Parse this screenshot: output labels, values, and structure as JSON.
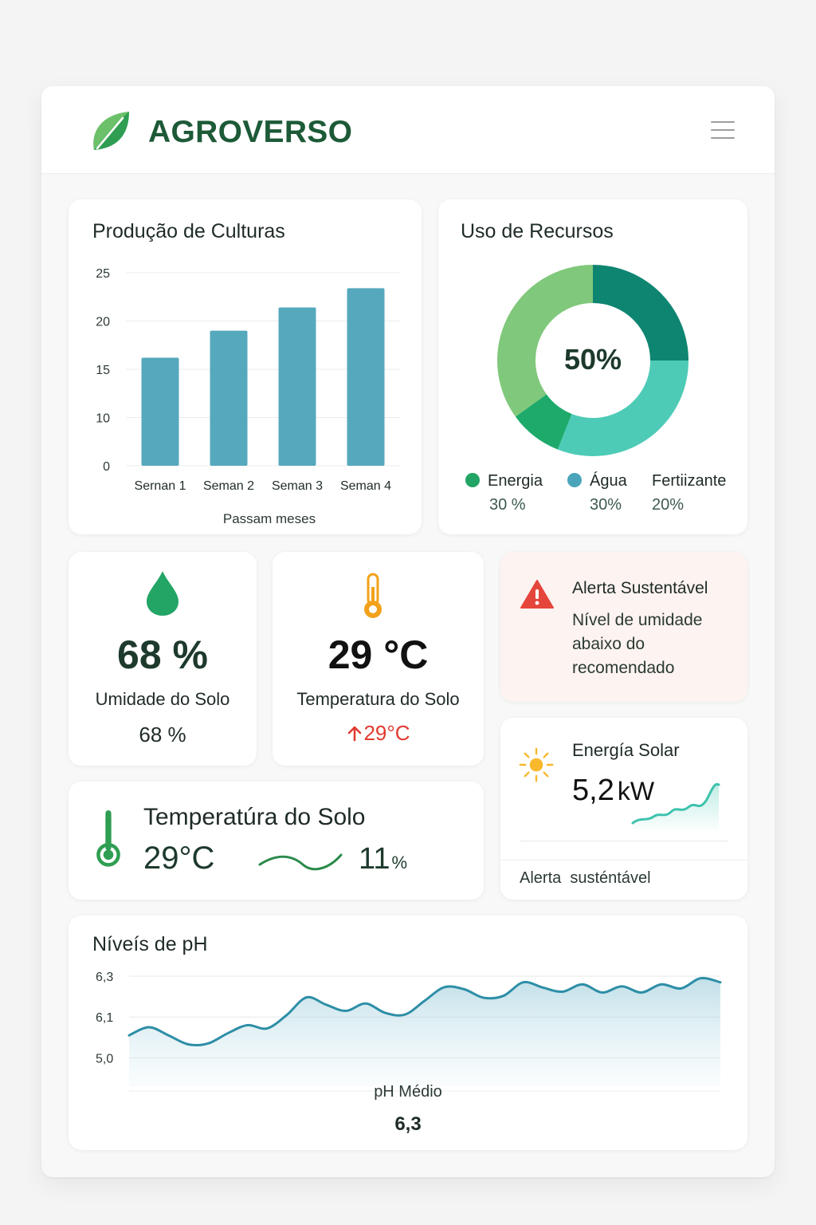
{
  "app": {
    "brand": "AGROVERSO"
  },
  "colors": {
    "brand": "#1d5a37",
    "bar": "#56a8bd",
    "line": "#2d8ea6",
    "alert": "#e03a2f"
  },
  "crop_card": {
    "title": "Produção de Culturas"
  },
  "resources_card": {
    "title": "Uso de Recursos",
    "center_value": "50%",
    "legend": [
      {
        "name": "Energia",
        "pct": "30 %",
        "color": "#22a565"
      },
      {
        "name": "Água",
        "pct": "30%",
        "color": "#4aa5ba"
      },
      {
        "name": "Fertiizante",
        "pct": "20%",
        "color": "#81c97d"
      }
    ]
  },
  "moisture_card": {
    "icon": "water-drop-icon",
    "value": "68 %",
    "label": "Umidade do Solo",
    "sub": "68 %"
  },
  "soil_temp_card": {
    "icon": "thermometer-icon",
    "value": "29 °C",
    "label": "Temperatura do Solo",
    "change": "29°C"
  },
  "alert_card": {
    "icon": "warning-icon",
    "title": "Alerta Sustentável",
    "line1": "Nível de umidade",
    "line2": "abaixo do",
    "line3": "recomendado"
  },
  "solar_card": {
    "icon": "sun-icon",
    "title": "Energía Solar",
    "value": "5,2",
    "unit": "kW",
    "footer": "Alerta  susténtável"
  },
  "soil_temp_wide": {
    "icon": "thermometer-icon",
    "title": "Temperatúra do Solo",
    "value": "29°C",
    "percent": "11",
    "percent_unit": "%"
  },
  "ph_card": {
    "title": "Níveís de pH",
    "avg_label": "pH Médio",
    "avg_value": "6,3"
  },
  "chart_data": [
    {
      "type": "bar",
      "title": "Produção de Culturas",
      "categories": [
        "Sernan 1",
        "Seman 2",
        "Seman 3",
        "Seman 4"
      ],
      "values": [
        14,
        17.5,
        20.5,
        23
      ],
      "xlabel": "Passam meses",
      "ylabel": "",
      "ylim": [
        0,
        25
      ],
      "yticks": [
        {
          "label": "25",
          "value": 25
        },
        {
          "label": "20",
          "value": 20
        },
        {
          "label": "15",
          "value": 15
        },
        {
          "label": "10",
          "value": 10
        },
        {
          "label": "0",
          "value": 0
        }
      ],
      "grid": true
    },
    {
      "type": "pie",
      "title": "Uso de Recursos",
      "slices": [
        {
          "value": 25,
          "color": "#0e8571"
        },
        {
          "value": 31,
          "color": "#4ecbb7"
        },
        {
          "value": 9,
          "color": "#1daa6b"
        },
        {
          "value": 35,
          "color": "#80c87b"
        }
      ]
    },
    {
      "type": "area",
      "title": "Níveís de pH",
      "x": [
        0,
        1,
        2,
        3,
        4,
        5,
        6,
        7,
        8,
        9,
        10,
        11,
        12,
        13,
        14,
        15,
        16,
        17,
        18,
        19,
        20,
        21,
        22,
        23,
        24,
        25,
        26,
        27,
        28,
        29,
        30
      ],
      "values": [
        5.55,
        5.75,
        5.55,
        5.33,
        5.35,
        5.6,
        5.8,
        5.72,
        6.05,
        6.48,
        6.3,
        6.15,
        6.33,
        6.1,
        6.06,
        6.4,
        6.73,
        6.68,
        6.47,
        6.52,
        6.85,
        6.72,
        6.62,
        6.8,
        6.6,
        6.75,
        6.6,
        6.8,
        6.7,
        6.95,
        6.85
      ],
      "yticks": [
        {
          "label": "6,3",
          "value": 7.0
        },
        {
          "label": "6,1",
          "value": 6.0
        },
        {
          "label": "5,0",
          "value": 5.0
        }
      ],
      "ylim": [
        4.5,
        7.0
      ],
      "grid": true
    }
  ]
}
